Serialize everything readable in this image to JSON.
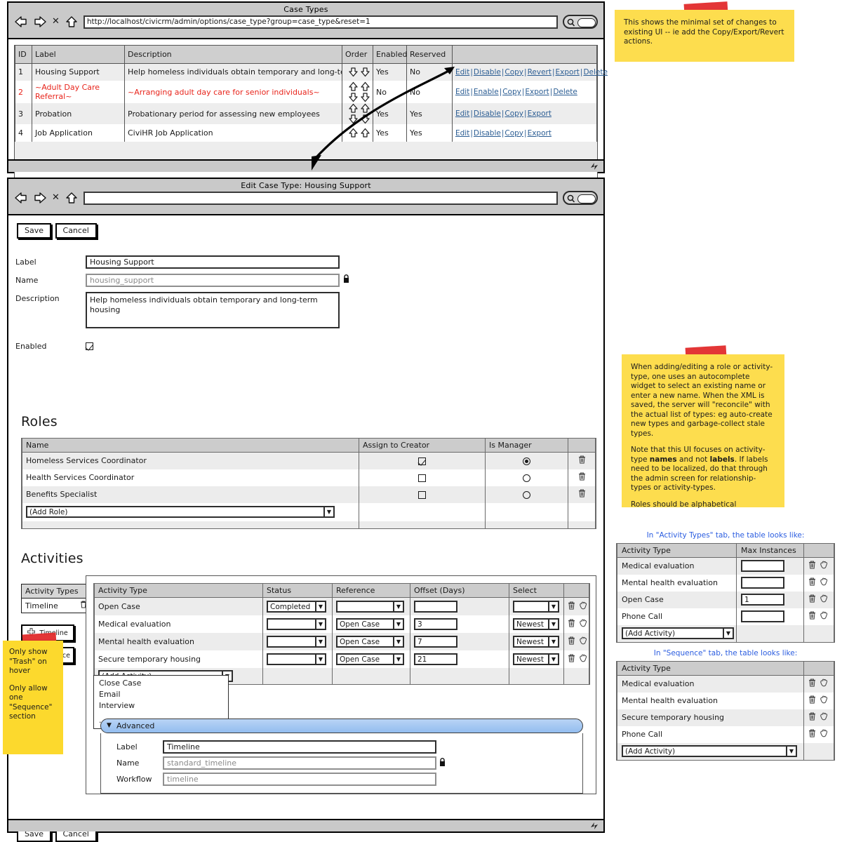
{
  "window1": {
    "title": "Case Types",
    "url": "http://localhost/civicrm/admin/options/case_type?group=case_type&reset=1",
    "nav": {
      "back": "back-arrow",
      "forward": "forward-arrow",
      "stop": "X",
      "home": "home"
    },
    "table": {
      "headers": [
        "ID",
        "Label",
        "Description",
        "Order",
        "Enabled",
        "Reserved",
        ""
      ],
      "rows": [
        {
          "id": "1",
          "label": "Housing Support",
          "description": "Help homeless individuals obtain temporary and long-term housing",
          "order": "down",
          "enabled": "Yes",
          "reserved": "No",
          "actions": [
            "Edit",
            "Disable",
            "Copy",
            "Revert",
            "Export",
            "Delete"
          ],
          "highlight": false
        },
        {
          "id": "2",
          "label": "~Adult Day Care Referral~",
          "description": "~Arranging adult day care for senior individuals~",
          "order": "updown",
          "enabled": "No",
          "reserved": "No",
          "actions": [
            "Edit",
            "Enable",
            "Copy",
            "Export",
            "Delete"
          ],
          "highlight": true
        },
        {
          "id": "3",
          "label": "Probation",
          "description": "Probationary period for assessing new employees",
          "order": "updown",
          "enabled": "Yes",
          "reserved": "Yes",
          "actions": [
            "Edit",
            "Disable",
            "Copy",
            "Export"
          ],
          "highlight": false
        },
        {
          "id": "4",
          "label": "Job Application",
          "description": "CiviHR Job Application",
          "order": "up",
          "enabled": "Yes",
          "reserved": "Yes",
          "actions": [
            "Edit",
            "Disable",
            "Copy",
            "Export"
          ],
          "highlight": false
        }
      ]
    }
  },
  "window2": {
    "title": "Edit Case Type: Housing Support",
    "url": "",
    "toolbar": {
      "save": "Save",
      "cancel": "Cancel"
    },
    "footer": {
      "save": "Save",
      "cancel": "Cancel"
    },
    "form": {
      "label_label": "Label",
      "label_value": "Housing Support",
      "name_label": "Name",
      "name_placeholder": "housing_support",
      "description_label": "Description",
      "description_value": "Help homeless individuals obtain temporary and long-term housing",
      "enabled_label": "Enabled",
      "enabled_checked": true
    },
    "roles": {
      "heading": "Roles",
      "headers": [
        "Name",
        "Assign to Creator",
        "Is Manager",
        ""
      ],
      "rows": [
        {
          "name": "Homeless Services Coordinator",
          "assign": true,
          "manager": true
        },
        {
          "name": "Health Services Coordinator",
          "assign": false,
          "manager": false
        },
        {
          "name": "Benefits Specialist",
          "assign": false,
          "manager": false
        }
      ],
      "add_role": "(Add Role)"
    },
    "activities": {
      "heading": "Activities",
      "tab_group_label": "Activity Types",
      "current_tab": "Timeline",
      "add_timeline": "Timeline",
      "add_sequence": "Sequence",
      "headers": [
        "Activity Type",
        "Status",
        "Reference",
        "Offset (Days)",
        "Select",
        ""
      ],
      "rows": [
        {
          "type": "Open Case",
          "status": "Completed",
          "reference": "",
          "offset": "",
          "select": ""
        },
        {
          "type": "Medical evaluation",
          "status": "",
          "reference": "Open Case",
          "offset": "3",
          "select": "Newest"
        },
        {
          "type": "Mental health evaluation",
          "status": "",
          "reference": "Open Case",
          "offset": "7",
          "select": "Newest"
        },
        {
          "type": "Secure temporary housing",
          "status": "",
          "reference": "Open Case",
          "offset": "21",
          "select": "Newest"
        }
      ],
      "add_activity": "(Add Activity)",
      "dropdown_options": [
        "Close Case",
        "Email",
        "Interview",
        "..."
      ]
    },
    "advanced": {
      "title": "Advanced",
      "label_label": "Label",
      "label_value": "Timeline",
      "name_label": "Name",
      "name_placeholder": "standard_timeline",
      "workflow_label": "Workflow",
      "workflow_placeholder": "timeline"
    }
  },
  "notes": {
    "top": "This shows the minimal set of changes to existing UI -- ie add the Copy/Export/Revert actions.",
    "middle_p1": "When adding/editing a role or activity-type, one uses an autocomplete widget to select an existing name or enter a new name. When the XML is saved, the server will \"reconcile\" with the actual list of types: eg auto-create new types and garbage-collect stale types.",
    "middle_p2_a": "Note that this UI focuses on activity-type ",
    "middle_p2_b": "names",
    "middle_p2_c": " and not ",
    "middle_p2_d": "labels",
    "middle_p2_e": ". If labels need to be localized, do that through the admin screen for relationship-types or activity-types.",
    "middle_p3": "Roles should be alphabetical",
    "left_p1": "Only show \"Trash\" on hover",
    "left_p2": "Only allow one \"Sequence\" section"
  },
  "right_panel": {
    "activity_types": {
      "caption": "In \"Activity Types\" tab, the table looks like:",
      "headers": [
        "Activity Type",
        "Max Instances",
        ""
      ],
      "rows": [
        {
          "type": "Medical evaluation",
          "max": ""
        },
        {
          "type": "Mental health evaluation",
          "max": ""
        },
        {
          "type": "Open Case",
          "max": "1"
        },
        {
          "type": "Phone Call",
          "max": ""
        }
      ],
      "add_activity": "(Add Activity)"
    },
    "sequence": {
      "caption": "In \"Sequence\" tab, the table looks like:",
      "headers": [
        "Activity Type",
        ""
      ],
      "rows": [
        {
          "type": "Medical evaluation"
        },
        {
          "type": "Mental health evaluation"
        },
        {
          "type": "Secure temporary housing"
        },
        {
          "type": "Phone Call"
        }
      ],
      "add_activity": "(Add Activity)"
    }
  },
  "colors": {
    "sticky": "#fddd4e",
    "tape": "#e12b2b",
    "link": "#2b5d93",
    "caption": "#2b5de0",
    "red_text": "#e8241b",
    "chrome": "#c9c9c9",
    "header_row": "#cccccc",
    "accordion": "#93bdef"
  }
}
